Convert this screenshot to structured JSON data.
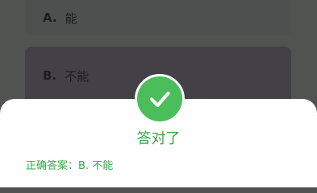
{
  "question": {
    "options": [
      {
        "letter": "A.",
        "text": "能"
      },
      {
        "letter": "B.",
        "text": "不能"
      }
    ]
  },
  "result": {
    "title": "答对了",
    "answer_label": "正确答案：",
    "answer_value": "B. 不能",
    "icon": "check-icon",
    "accent_color": "#4bbd5a",
    "text_color": "#35a648"
  }
}
